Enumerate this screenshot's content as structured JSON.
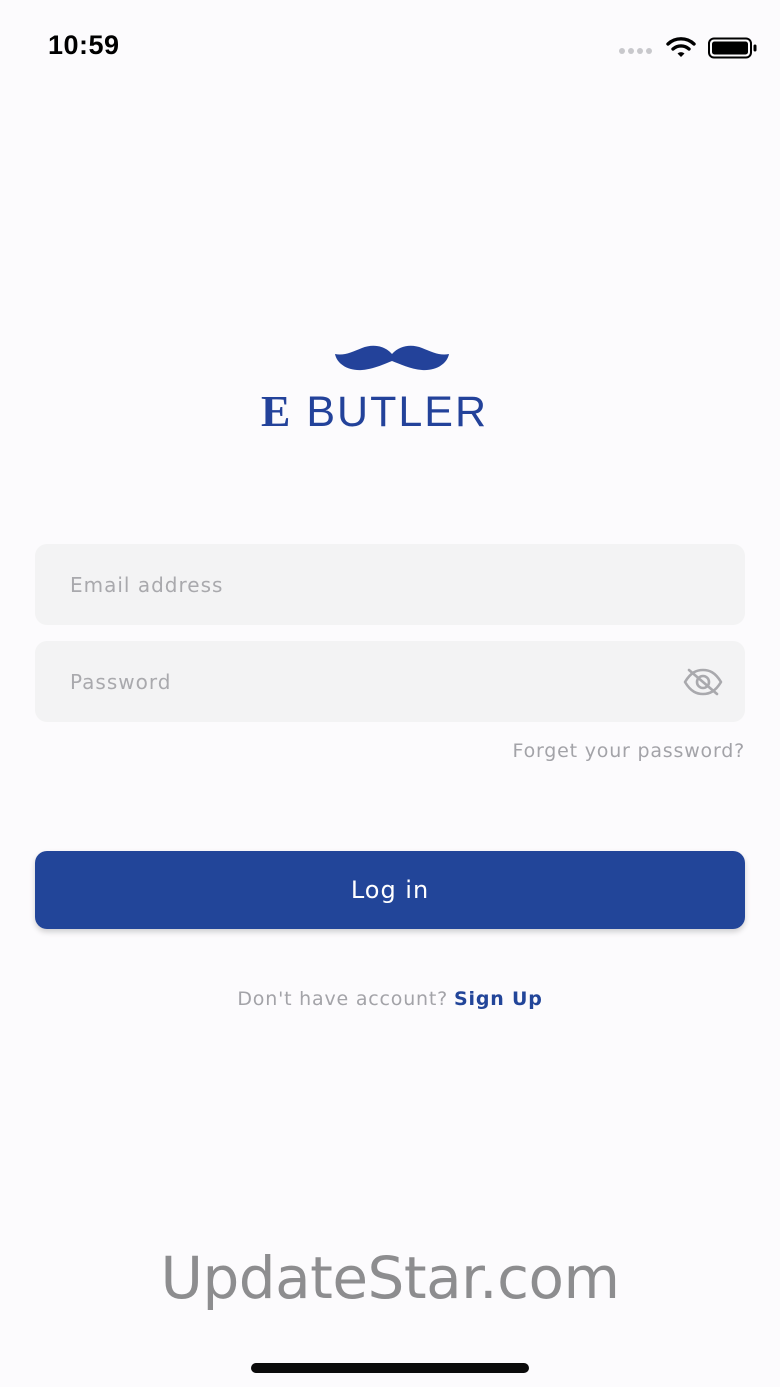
{
  "status_bar": {
    "time": "10:59",
    "icons": [
      "signal-dots-icon",
      "wifi-icon",
      "battery-icon"
    ]
  },
  "logo": {
    "icon": "mustache-icon",
    "letter": "E",
    "wordmark": "BUTLER"
  },
  "login_form": {
    "email_placeholder": "Email address",
    "email_value": "",
    "password_placeholder": "Password",
    "password_value": "",
    "password_toggle_icon": "eye-slash-icon",
    "forgot_password_label": "Forget your password?",
    "login_button_label": "Log in"
  },
  "signup": {
    "prompt": "Don't have account?",
    "link_label": "Sign Up"
  },
  "watermark": "UpdateStar.com",
  "colors": {
    "primary": "#224599",
    "field_background": "#f3f3f4",
    "muted_text": "#a3a3a8"
  }
}
